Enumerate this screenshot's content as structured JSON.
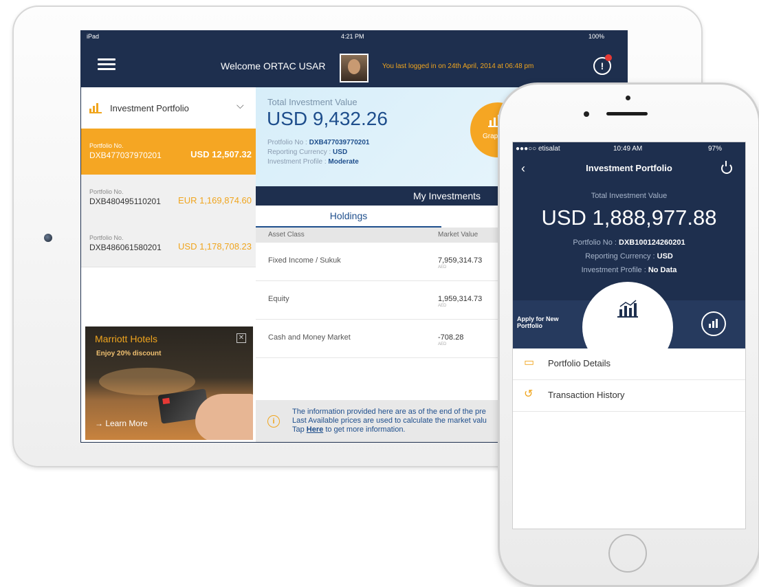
{
  "ipad": {
    "status": {
      "device": "iPad",
      "time": "4:21 PM",
      "battery": "100%"
    },
    "header": {
      "welcome": "Welcome ORTAC USAR",
      "last_login": "You last logged in on 24th April, 2014 at 06:48 pm"
    },
    "sidebar": {
      "selector_label": "Investment Portfolio",
      "portfolios": [
        {
          "label": "Portfolio No.",
          "number": "DXB477037970201",
          "amount": "USD 12,507.32"
        },
        {
          "label": "Portfolio No.",
          "number": "DXB480495110201",
          "amount": "EUR 1,169,874.60"
        },
        {
          "label": "Portfolio No.",
          "number": "DXB486061580201",
          "amount": "USD 1,178,708.23"
        }
      ],
      "ad": {
        "title": "Marriott Hotels",
        "subtitle": "Enjoy 20% discount",
        "cta": "→ Learn More"
      }
    },
    "summary": {
      "total_label": "Total Investment Value",
      "total_value": "USD 9,432.26",
      "portfolio_no_label": "Protfolio No : ",
      "portfolio_no": "DXB477039770201",
      "reporting_currency_label": "Reporting Currency : ",
      "reporting_currency": "USD",
      "investment_profile_label": "Investment Profile : ",
      "investment_profile": "Moderate",
      "graph_button": "Grap"
    },
    "investments": {
      "title": "My Investments",
      "tab": "Holdings",
      "columns": [
        "Asset Class",
        "Market Value"
      ],
      "rows": [
        {
          "asset": "Fixed Income / Sukuk",
          "value": "7,959,314.73",
          "currency": "AED"
        },
        {
          "asset": "Equity",
          "value": "1,959,314.73",
          "currency": "AED"
        },
        {
          "asset": "Cash and Money Market",
          "value": "-708.28",
          "currency": "AED"
        }
      ]
    },
    "info": {
      "line1": "The information provided here are as of the end of the pre",
      "line2": "Last Available prices are used to calculate the market valu",
      "line3_pre": "Tap ",
      "line3_link": "Here",
      "line3_post": " to get more information."
    }
  },
  "iphone": {
    "status": {
      "carrier": "●●●○○ etisalat",
      "time": "10:49 AM",
      "battery": "97%"
    },
    "title": "Investment Portfolio",
    "total_label": "Total Investment Value",
    "total_value": "USD 1,888,977.88",
    "portfolio_no_label": "Portfolio No : ",
    "portfolio_no": "DXB100124260201",
    "reporting_currency_label": "Reporting Currency : ",
    "reporting_currency": "USD",
    "investment_profile_label": "Investment Profile : ",
    "investment_profile": "No Data",
    "apply_line1": "Apply for New",
    "apply_line2": "Portfolio",
    "menu": [
      {
        "label": "Portfolio Details",
        "icon": "chart-board-icon"
      },
      {
        "label": "Transaction History",
        "icon": "history-icon"
      }
    ]
  },
  "colors": {
    "navy": "#1e2f4e",
    "accent": "#f5a623",
    "link_blue": "#1e4e8c"
  }
}
